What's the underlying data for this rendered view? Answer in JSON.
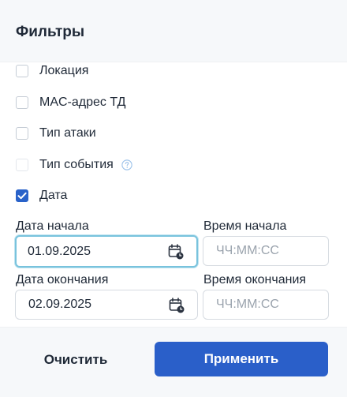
{
  "header": {
    "title": "Фильтры"
  },
  "filters": [
    {
      "label": "Локация",
      "checked": false,
      "disabled": false
    },
    {
      "label": "MAC-адрес ТД",
      "checked": false,
      "disabled": false
    },
    {
      "label": "Тип атаки",
      "checked": false,
      "disabled": false
    },
    {
      "label": "Тип события",
      "checked": false,
      "disabled": true,
      "help_icon": "question-circle-icon"
    },
    {
      "label": "Дата",
      "checked": true,
      "disabled": false
    }
  ],
  "date_range": {
    "start_date_label": "Дата начала",
    "start_date_value": "01.09.2025",
    "start_time_label": "Время начала",
    "start_time_placeholder": "ЧЧ:ММ:СС",
    "end_date_label": "Дата окончания",
    "end_date_value": "02.09.2025",
    "end_time_label": "Время окончания",
    "end_time_placeholder": "ЧЧ:ММ:СС",
    "calendar_icon": "calendar-clock-icon"
  },
  "footer": {
    "clear_label": "Очистить",
    "apply_label": "Применить"
  },
  "colors": {
    "accent": "#2a5fc9",
    "focus_ring": "#79c3dd",
    "header_bg": "#f6f8fa"
  }
}
